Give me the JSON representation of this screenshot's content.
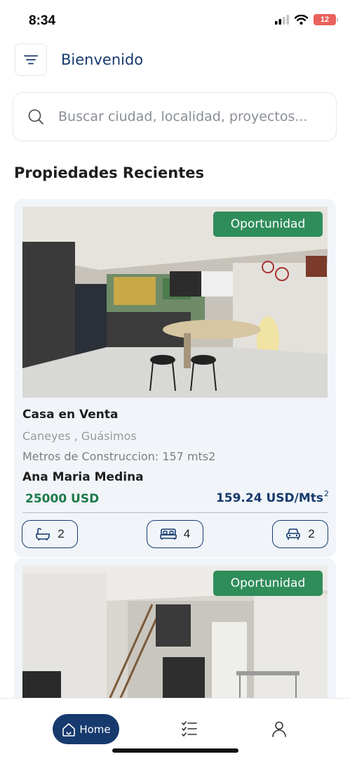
{
  "status_bar": {
    "time": "8:34",
    "battery": "12"
  },
  "header": {
    "title": "Bienvenido"
  },
  "search": {
    "placeholder": "Buscar ciudad, localidad, proyectos..."
  },
  "section": {
    "title": "Propiedades Recientes"
  },
  "listings": [
    {
      "badge": "Oportunidad",
      "title": "Casa en Venta",
      "location": "Caneyes , Guásimos",
      "construction": "Metros de Construccion: 157 mts2",
      "agent": "Ana Maria Medina",
      "price": "25000 USD",
      "price_per_m2": "159.24 USD/Mts",
      "price_per_m2_sup": "2",
      "bathrooms": "2",
      "bedrooms": "4",
      "parking": "2"
    },
    {
      "badge": "Oportunidad"
    }
  ],
  "bottom_nav": {
    "home_label": "Home"
  },
  "colors": {
    "primary": "#173a6e",
    "badge": "#2f8d5a",
    "price": "#1f7a4a",
    "card_bg": "#f1f5f9"
  }
}
